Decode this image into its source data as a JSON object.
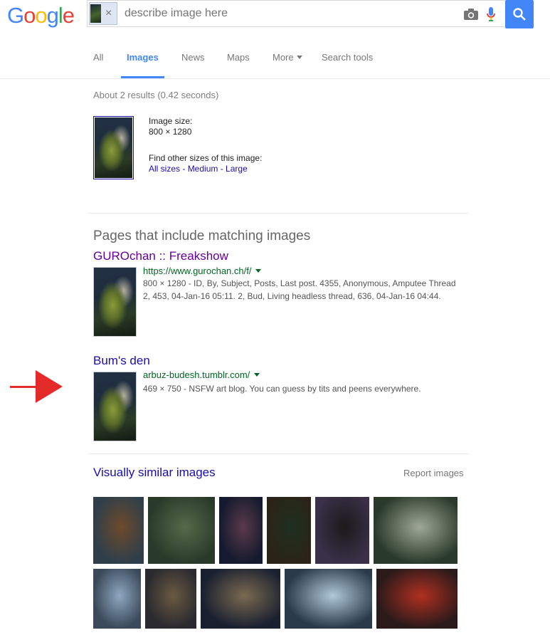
{
  "header": {
    "logo": "Google",
    "logo_colors": [
      "#4285f4",
      "#ea4335",
      "#fbbc05",
      "#4285f4",
      "#34a853",
      "#ea4335"
    ],
    "search_placeholder": "describe image here",
    "clear_chip": "×"
  },
  "tabs": [
    {
      "label": "All",
      "active": false
    },
    {
      "label": "Images",
      "active": true
    },
    {
      "label": "News",
      "active": false
    },
    {
      "label": "Maps",
      "active": false
    },
    {
      "label": "More",
      "active": false
    },
    {
      "label": "Search tools",
      "active": false
    }
  ],
  "stats": "About 2 results (0.42 seconds)",
  "image_info": {
    "size_label": "Image size:",
    "size_value": "800 × 1280",
    "find_label": "Find other sizes of this image:",
    "links": [
      "All sizes",
      "Medium",
      "Large"
    ],
    "separator": " - "
  },
  "pages_section": {
    "title": "Pages that include matching images",
    "results": [
      {
        "title": "GUROchan :: Freakshow",
        "url": "https://www.gurochan.ch/f/",
        "snippet": "800 × 1280 - ID, By, Subject, Posts, Last post. 4355, Anonymous, Amputee Thread 2, 453, 04-Jan-16 05:11. 2, Bud, Living headless thread, 636, 04-Jan-16 04:44."
      },
      {
        "title": "Bum's den",
        "url": "arbuz-budesh.tumblr.com/",
        "snippet": "469 × 750 - NSFW art blog. You can guess by tits and peens everywhere."
      }
    ]
  },
  "similar": {
    "title": "Visually similar images",
    "report": "Report images",
    "row1_colors": [
      [
        "#2f3f4a",
        "#6d4a2a"
      ],
      [
        "#2a3a2a",
        "#556a4a"
      ],
      [
        "#151a2e",
        "#5a3a4a"
      ],
      [
        "#2a2418",
        "#1f2f1f"
      ],
      [
        "#3a3048",
        "#1a1a1a"
      ],
      [
        "#2a3a2a",
        "#a0a898"
      ]
    ],
    "row2_colors": [
      [
        "#3a4a5a",
        "#8fa7c0"
      ],
      [
        "#2a2a30",
        "#6a5a40"
      ],
      [
        "#1a2030",
        "#7a6a50"
      ],
      [
        "#2a3a4a",
        "#b0c8d8"
      ],
      [
        "#2a1a1a",
        "#b03020"
      ]
    ]
  },
  "accent_colors": {
    "link": "#1a0dab",
    "visited": "#609",
    "url": "#006621",
    "blue": "#4285f4",
    "arrow": "#e52a2a"
  }
}
